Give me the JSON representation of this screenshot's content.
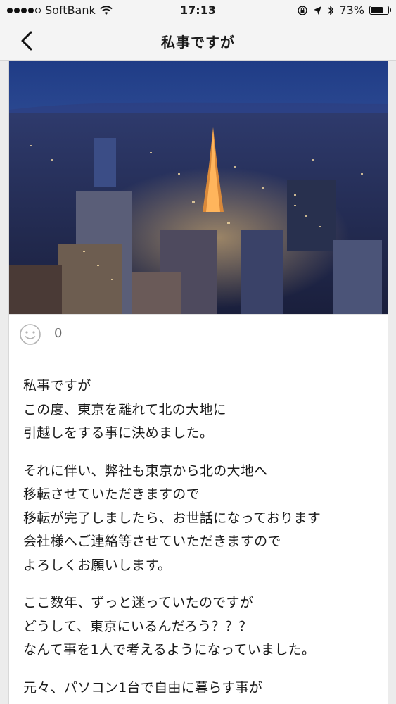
{
  "status_bar": {
    "carrier": "SoftBank",
    "time": "17:13",
    "battery": "73%",
    "battery_level": 0.73,
    "signal_bars_filled": 4,
    "signal_bars_total": 5
  },
  "nav": {
    "title": "私事ですが"
  },
  "post": {
    "like_count": "0"
  },
  "article": {
    "paragraphs": [
      [
        "私事ですが",
        "この度、東京を離れて北の大地に",
        "引越しをする事に決めました。"
      ],
      [
        "それに伴い、弊社も東京から北の大地へ",
        "移転させていただきますので",
        "移転が完了しましたら、お世話になっております",
        "会社様へご連絡等させていただきますので",
        "よろしくお願いします。"
      ],
      [
        "ここ数年、ずっと迷っていたのですが",
        "どうして、東京にいるんだろう？？？",
        "なんて事を1人で考えるようになっていました。"
      ],
      [
        "元々、パソコン1台で自由に暮らす事が"
      ]
    ]
  },
  "colors": {
    "background": "#ececec",
    "bar": "#f4f4f4",
    "text": "#1a1a1a"
  }
}
